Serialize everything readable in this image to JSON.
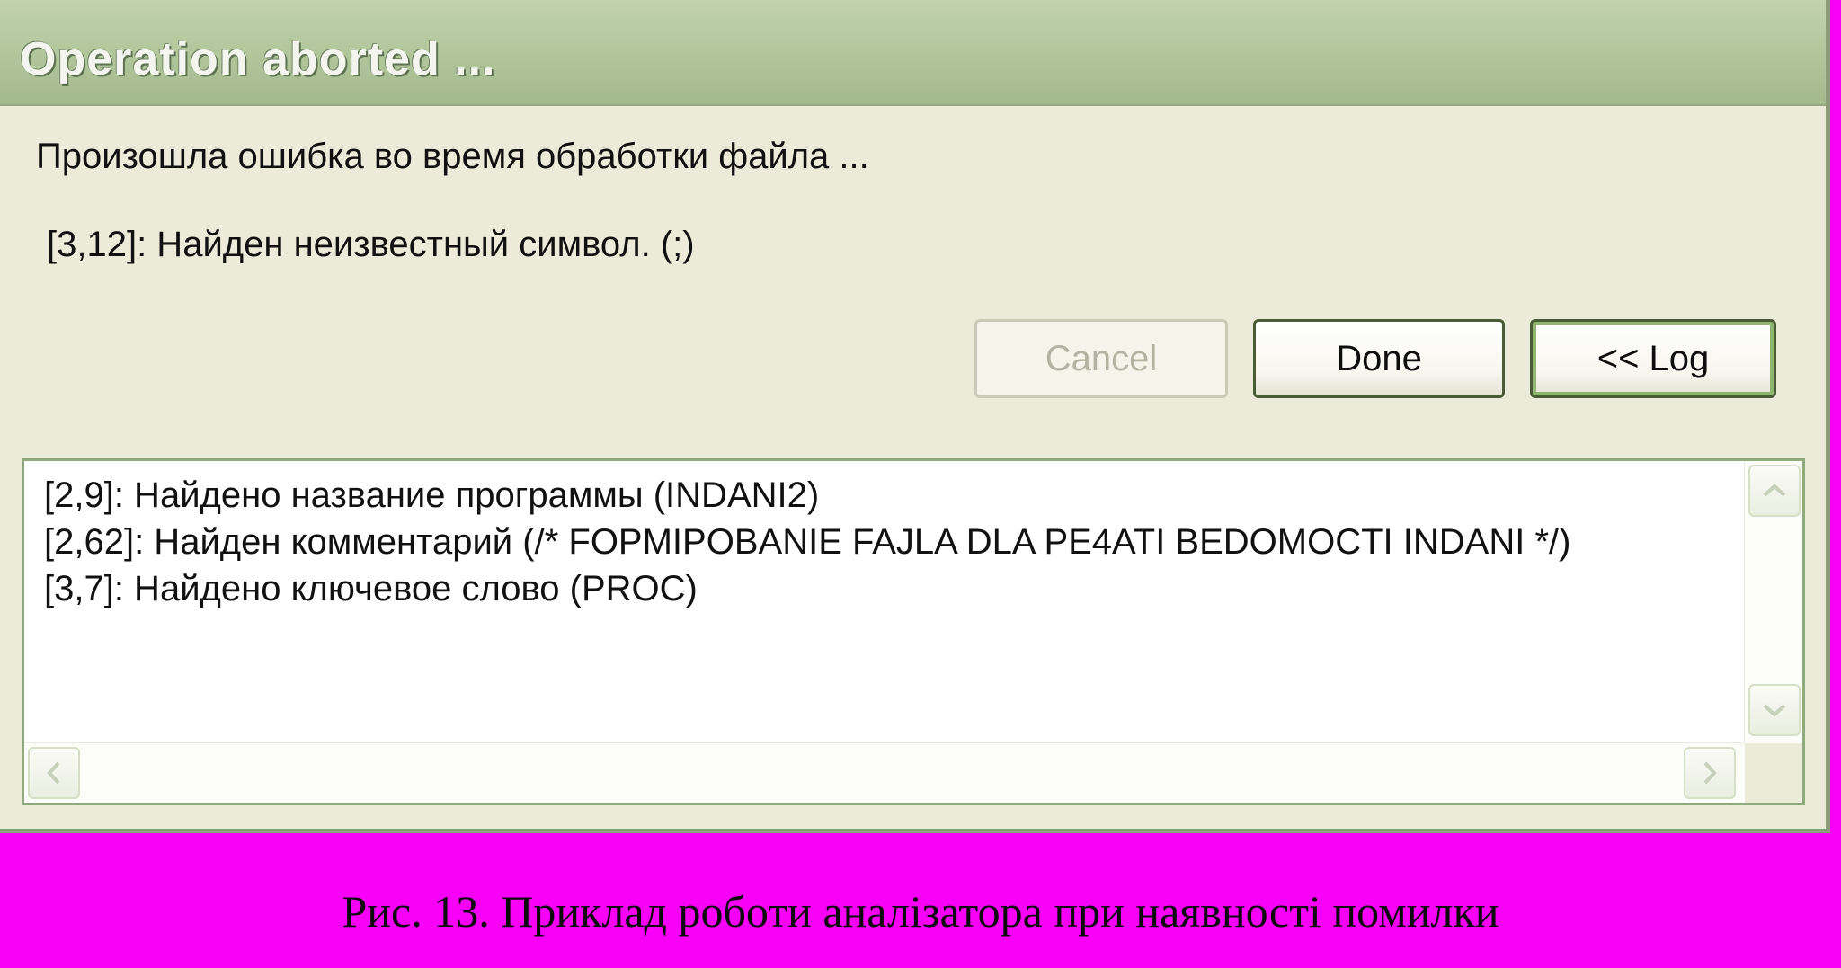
{
  "dialog": {
    "title": "Operation aborted ...",
    "message": "Произошла ошибка во время обработки файла ...",
    "error_detail": "[3,12]: Найден неизвестный символ. (;)",
    "buttons": {
      "cancel": "Cancel",
      "done": "Done",
      "log": "<< Log"
    },
    "log_lines": [
      "[2,9]: Найдено название программы (INDANI2)",
      "[2,62]: Найден комментарий (/* FOPMIPOBANIE FAJLA DLA PE4ATI BEDOMOCTI INDANI */)",
      "[3,7]: Найдено ключевое слово (PROC)"
    ],
    "scrollbar_icons": {
      "up": "chevron-up-icon",
      "down": "chevron-down-icon",
      "left": "chevron-left-icon",
      "right": "chevron-right-icon"
    }
  },
  "caption": "Рис. 13. Приклад роботи аналізатора при наявності помилки",
  "colors": {
    "background": "#f800f8",
    "dialog_face": "#ecead9",
    "title_bar": "#b1c59a",
    "button_border": "#4a5c35",
    "log_border": "#8eab7c"
  }
}
